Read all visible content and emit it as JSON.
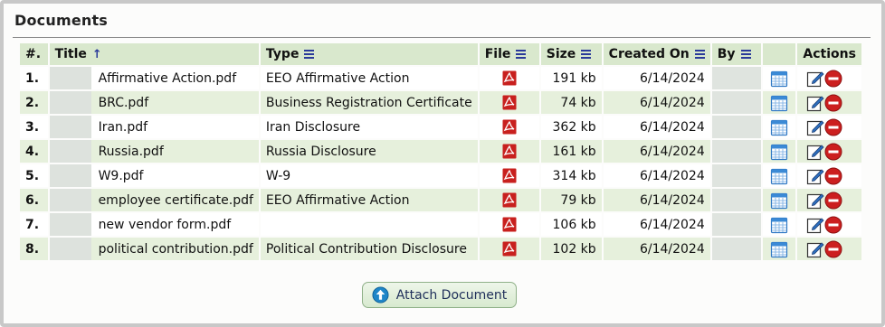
{
  "panel": {
    "title": "Documents"
  },
  "columns": {
    "num": "#.",
    "title": "Title",
    "type": "Type",
    "file": "File",
    "size": "Size",
    "created": "Created On",
    "by": "By",
    "actions": "Actions"
  },
  "rows": [
    {
      "num": "1.",
      "title": "Affirmative Action.pdf",
      "type": "EEO Affirmative Action",
      "size": "191 kb",
      "created": "6/14/2024"
    },
    {
      "num": "2.",
      "title": "BRC.pdf",
      "type": "Business Registration Certificate",
      "size": "74 kb",
      "created": "6/14/2024"
    },
    {
      "num": "3.",
      "title": "Iran.pdf",
      "type": "Iran Disclosure",
      "size": "362 kb",
      "created": "6/14/2024"
    },
    {
      "num": "4.",
      "title": "Russia.pdf",
      "type": "Russia Disclosure",
      "size": "161 kb",
      "created": "6/14/2024"
    },
    {
      "num": "5.",
      "title": "W9.pdf",
      "type": "W-9",
      "size": "314 kb",
      "created": "6/14/2024"
    },
    {
      "num": "6.",
      "title": "employee certificate.pdf",
      "type": "EEO Affirmative Action",
      "size": "79 kb",
      "created": "6/14/2024"
    },
    {
      "num": "7.",
      "title": "new vendor form.pdf",
      "type": "",
      "size": "106 kb",
      "created": "6/14/2024"
    },
    {
      "num": "8.",
      "title": "political contribution.pdf",
      "type": "Political Contribution Disclosure",
      "size": "102 kb",
      "created": "6/14/2024"
    }
  ],
  "attach_button": {
    "label": "Attach Document"
  },
  "icons": {
    "sort": "sort-ascending-icon",
    "column_menu": "column-menu-icon",
    "file": "pdf-icon",
    "calendar": "calendar-icon",
    "edit": "edit-icon",
    "delete": "delete-icon",
    "attach": "upload-arrow-icon"
  },
  "colors": {
    "header_bg": "#d9e8cd",
    "row_alt_bg": "#e6f0dc",
    "accent_blue": "#2a3a9a",
    "delete_red": "#cc1f1f",
    "pdf_red": "#c8201e"
  }
}
